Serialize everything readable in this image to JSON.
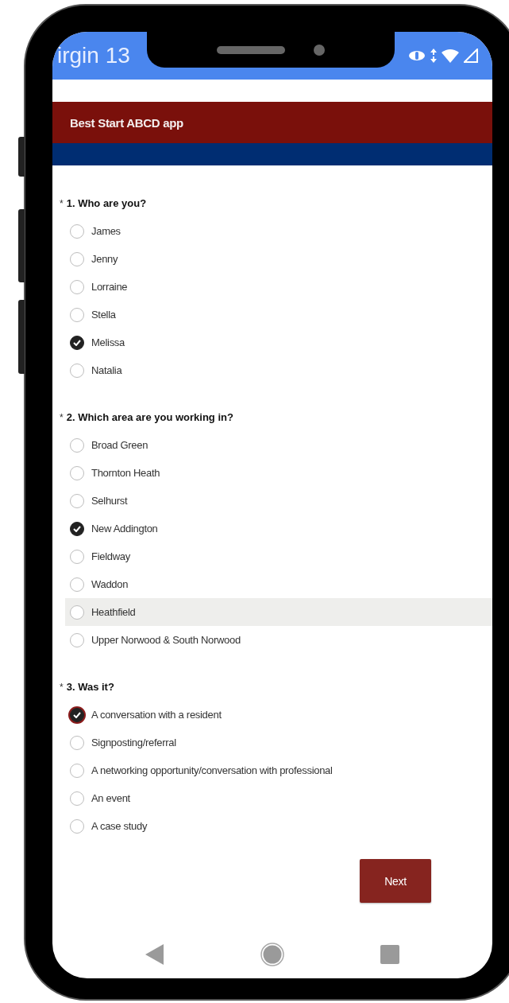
{
  "status_bar": {
    "carrier": "irgin 13"
  },
  "header": {
    "title": "Best Start ABCD app"
  },
  "questions": [
    {
      "required_mark": "*",
      "title": "1. Who are you?",
      "options": [
        {
          "label": "James",
          "selected": false,
          "hovered": false,
          "focused": false
        },
        {
          "label": "Jenny",
          "selected": false,
          "hovered": false,
          "focused": false
        },
        {
          "label": "Lorraine",
          "selected": false,
          "hovered": false,
          "focused": false
        },
        {
          "label": "Stella",
          "selected": false,
          "hovered": false,
          "focused": false
        },
        {
          "label": "Melissa",
          "selected": true,
          "hovered": false,
          "focused": false
        },
        {
          "label": "Natalia",
          "selected": false,
          "hovered": false,
          "focused": false
        }
      ]
    },
    {
      "required_mark": "*",
      "title": "2. Which area are you working in?",
      "options": [
        {
          "label": "Broad Green",
          "selected": false,
          "hovered": false,
          "focused": false
        },
        {
          "label": "Thornton Heath",
          "selected": false,
          "hovered": false,
          "focused": false
        },
        {
          "label": "Selhurst",
          "selected": false,
          "hovered": false,
          "focused": false
        },
        {
          "label": "New Addington",
          "selected": true,
          "hovered": false,
          "focused": false
        },
        {
          "label": "Fieldway",
          "selected": false,
          "hovered": false,
          "focused": false
        },
        {
          "label": "Waddon",
          "selected": false,
          "hovered": false,
          "focused": false
        },
        {
          "label": "Heathfield",
          "selected": false,
          "hovered": true,
          "focused": false
        },
        {
          "label": "Upper Norwood & South Norwood",
          "selected": false,
          "hovered": false,
          "focused": false
        }
      ]
    },
    {
      "required_mark": "*",
      "title": "3. Was it?",
      "options": [
        {
          "label": "A conversation with a resident",
          "selected": true,
          "hovered": false,
          "focused": true
        },
        {
          "label": "Signposting/referral",
          "selected": false,
          "hovered": false,
          "focused": false
        },
        {
          "label": "A networking opportunity/conversation with professional",
          "selected": false,
          "hovered": false,
          "focused": false
        },
        {
          "label": "An event",
          "selected": false,
          "hovered": false,
          "focused": false
        },
        {
          "label": "A case study",
          "selected": false,
          "hovered": false,
          "focused": false
        }
      ]
    }
  ],
  "next_button": {
    "label": "Next"
  }
}
